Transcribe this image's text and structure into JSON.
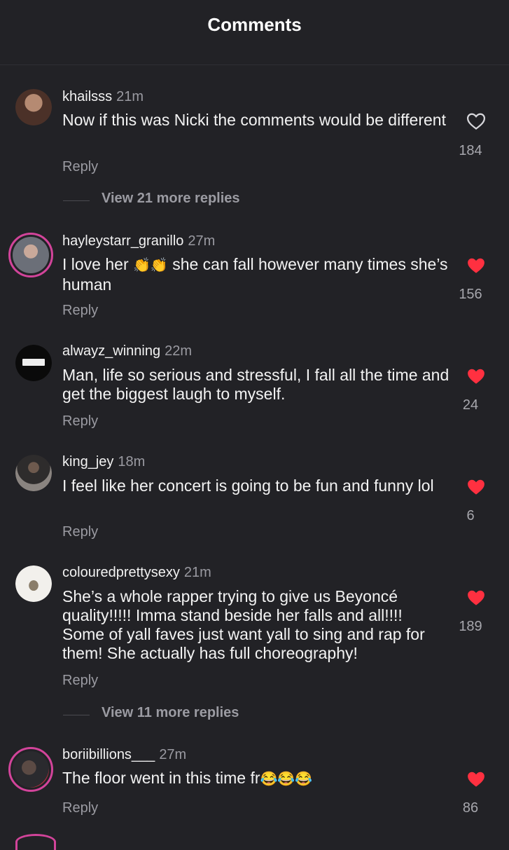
{
  "header": {
    "title": "Comments"
  },
  "comments": [
    {
      "username": "khailsss",
      "time": "21m",
      "text": "Now if this was Nicki the comments would be different",
      "reply": "Reply",
      "likes": "184",
      "liked": false,
      "view_more": "View 21 more replies",
      "avatar_color": "#6e5148"
    },
    {
      "username": "hayleystarr_granillo",
      "time": "27m",
      "text_before": "I love her",
      "text_emoji": "👏👏",
      "text_after": "she can fall however many times she’s human",
      "reply": "Reply",
      "likes": "156",
      "liked": true,
      "avatar_color": "#7a7f86"
    },
    {
      "username": "alwayz_winning",
      "time": "22m",
      "text": "Man, life so serious and stressful, I fall all the time and get the biggest laugh to myself.",
      "reply": "Reply",
      "likes": "24",
      "liked": true,
      "avatar_color": "#0a0a0a"
    },
    {
      "username": "king_jey",
      "time": "18m",
      "text": "I feel like her concert is going to be fun and funny lol",
      "reply": "Reply",
      "likes": "6",
      "liked": true,
      "avatar_color": "#5a5550"
    },
    {
      "username": "colouredprettysexy",
      "time": "21m",
      "text": "She’s a whole rapper trying to give us Beyoncé quality!!!!! Imma stand beside her falls and all!!!! Some of yall faves just want yall to sing and rap for them! She actually has full choreography!",
      "reply": "Reply",
      "likes": "189",
      "liked": true,
      "view_more": "View 11 more replies",
      "avatar_color": "#e8e6e2"
    },
    {
      "username": "boriibillions___",
      "time": "27m",
      "text": "The floor went in this time fr",
      "text_emoji": "😂😂😂",
      "reply": "Reply",
      "likes": "86",
      "liked": true,
      "avatar_color": "#3a3a3e"
    }
  ],
  "colors": {
    "accent_like": "#ff3040",
    "ring": "#d2449a",
    "background": "#222226"
  }
}
